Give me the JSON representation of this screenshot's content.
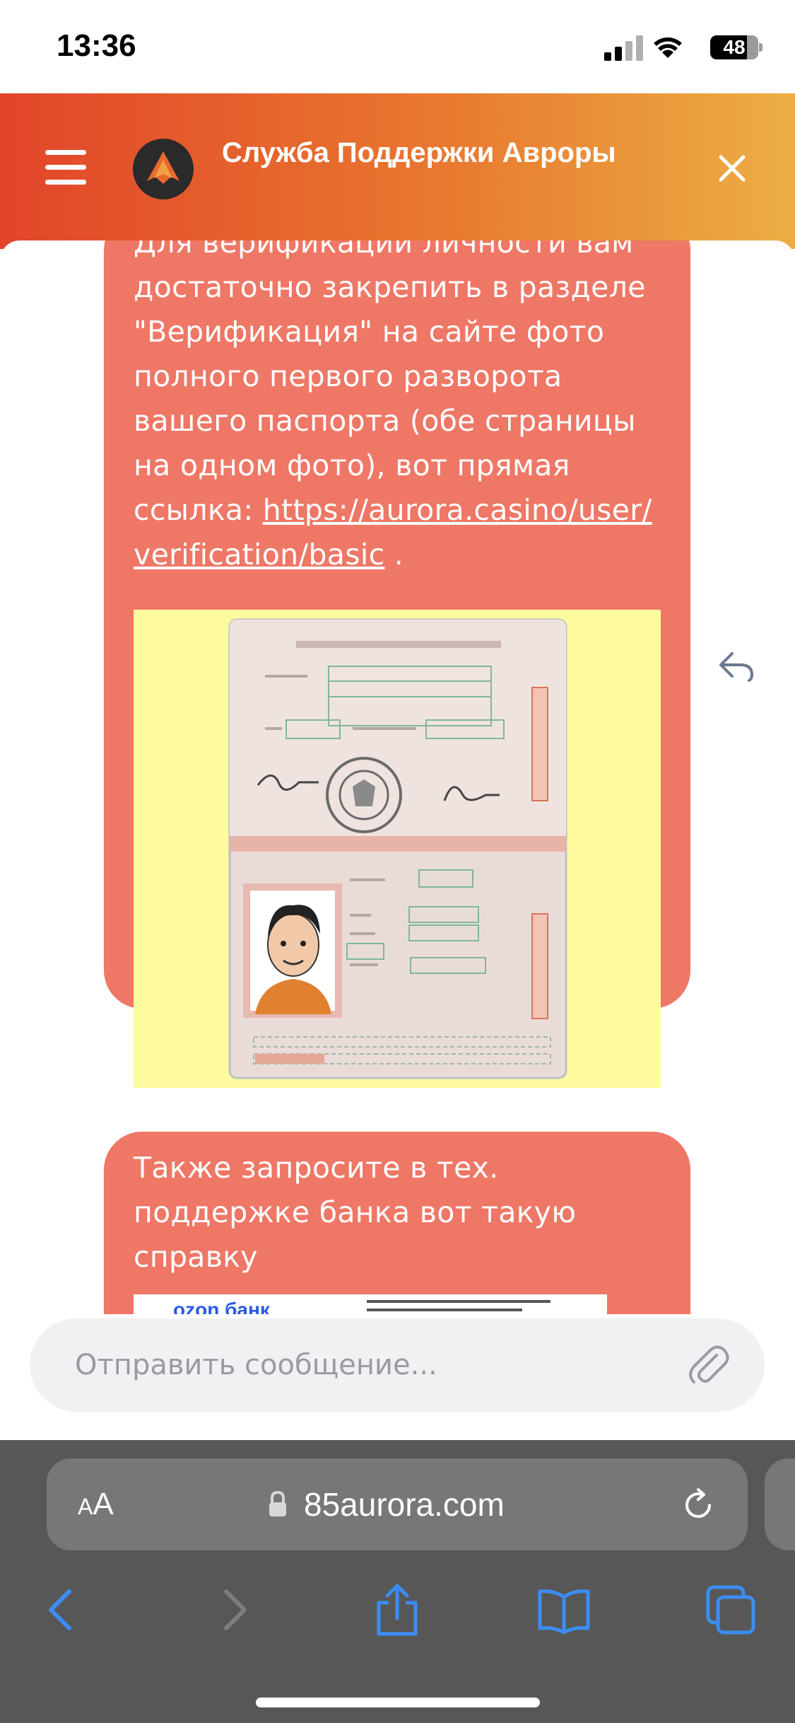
{
  "status_bar": {
    "time": "13:36",
    "battery": "48"
  },
  "header": {
    "title": "Служба Поддержки Авроры",
    "icons": [
      "menu-icon",
      "aurora-logo",
      "close-icon"
    ]
  },
  "messages": [
    {
      "text_before_link": "Для верификации личности вам достаточно закрепить в разделе \"Верификация\" на сайте фото полного первого разворота вашего паспорта (обе страницы на одном фото), вот прямая ссылка: ",
      "link": "https://aurora.casino/user/verification/basic",
      "text_after_link": " .",
      "attachment": "passport-image"
    },
    {
      "text": "Также запросите в тех. поддержке банка вот такую справку",
      "attachment_label": "ozon банк"
    }
  ],
  "composer": {
    "placeholder": "Отправить сообщение..."
  },
  "browser": {
    "aa_label_big": "A",
    "aa_label_small": "A",
    "url": "85aurora.com"
  },
  "colors": {
    "header_gradient_start": "#e2452a",
    "header_gradient_end": "#ecae45",
    "bubble": "#ee7766",
    "safari_toolbar": "#575757",
    "safari_accent": "#3b8df5"
  }
}
